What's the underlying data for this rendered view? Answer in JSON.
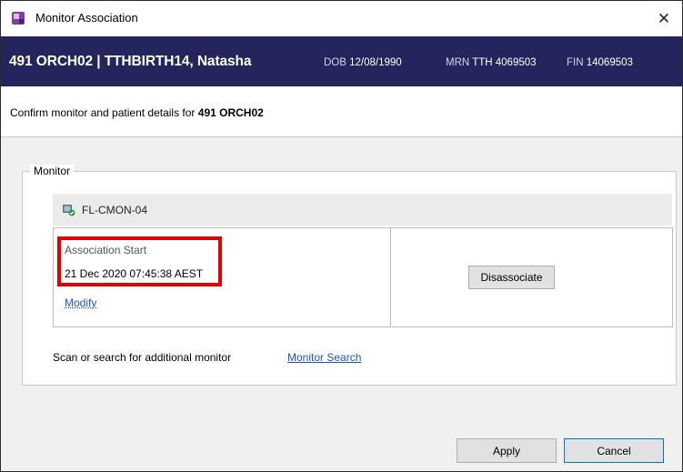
{
  "window": {
    "title": "Monitor Association",
    "close_glyph": "✕",
    "app_icon": "app-icon"
  },
  "banner": {
    "main": "491 ORCH02 | TTHBIRTH14, Natasha",
    "dob_label": "DOB",
    "dob_value": "12/08/1990",
    "mrn_label": "MRN",
    "mrn_value": "TTH 4069503",
    "fin_label": "FIN",
    "fin_value": "14069503",
    "background": "#25255e"
  },
  "confirm": {
    "prefix": "Confirm monitor and patient details for",
    "location": "491 ORCH02"
  },
  "monitor_group": {
    "legend": "Monitor",
    "monitor_name": "FL-CMON-04",
    "monitor_icon": "monitor-device-icon",
    "association_label": "Association Start",
    "association_value": "21 Dec 2020 07:45:38 AEST",
    "modify_label": "Modify",
    "disassociate_label": "Disassociate",
    "highlight_color": "#e30000"
  },
  "scan": {
    "text": "Scan or search for additional monitor",
    "search_link": "Monitor Search"
  },
  "footer": {
    "apply_label": "Apply",
    "cancel_label": "Cancel"
  },
  "colors": {
    "link": "#1a57c2",
    "accent_border": "#0078d7"
  }
}
